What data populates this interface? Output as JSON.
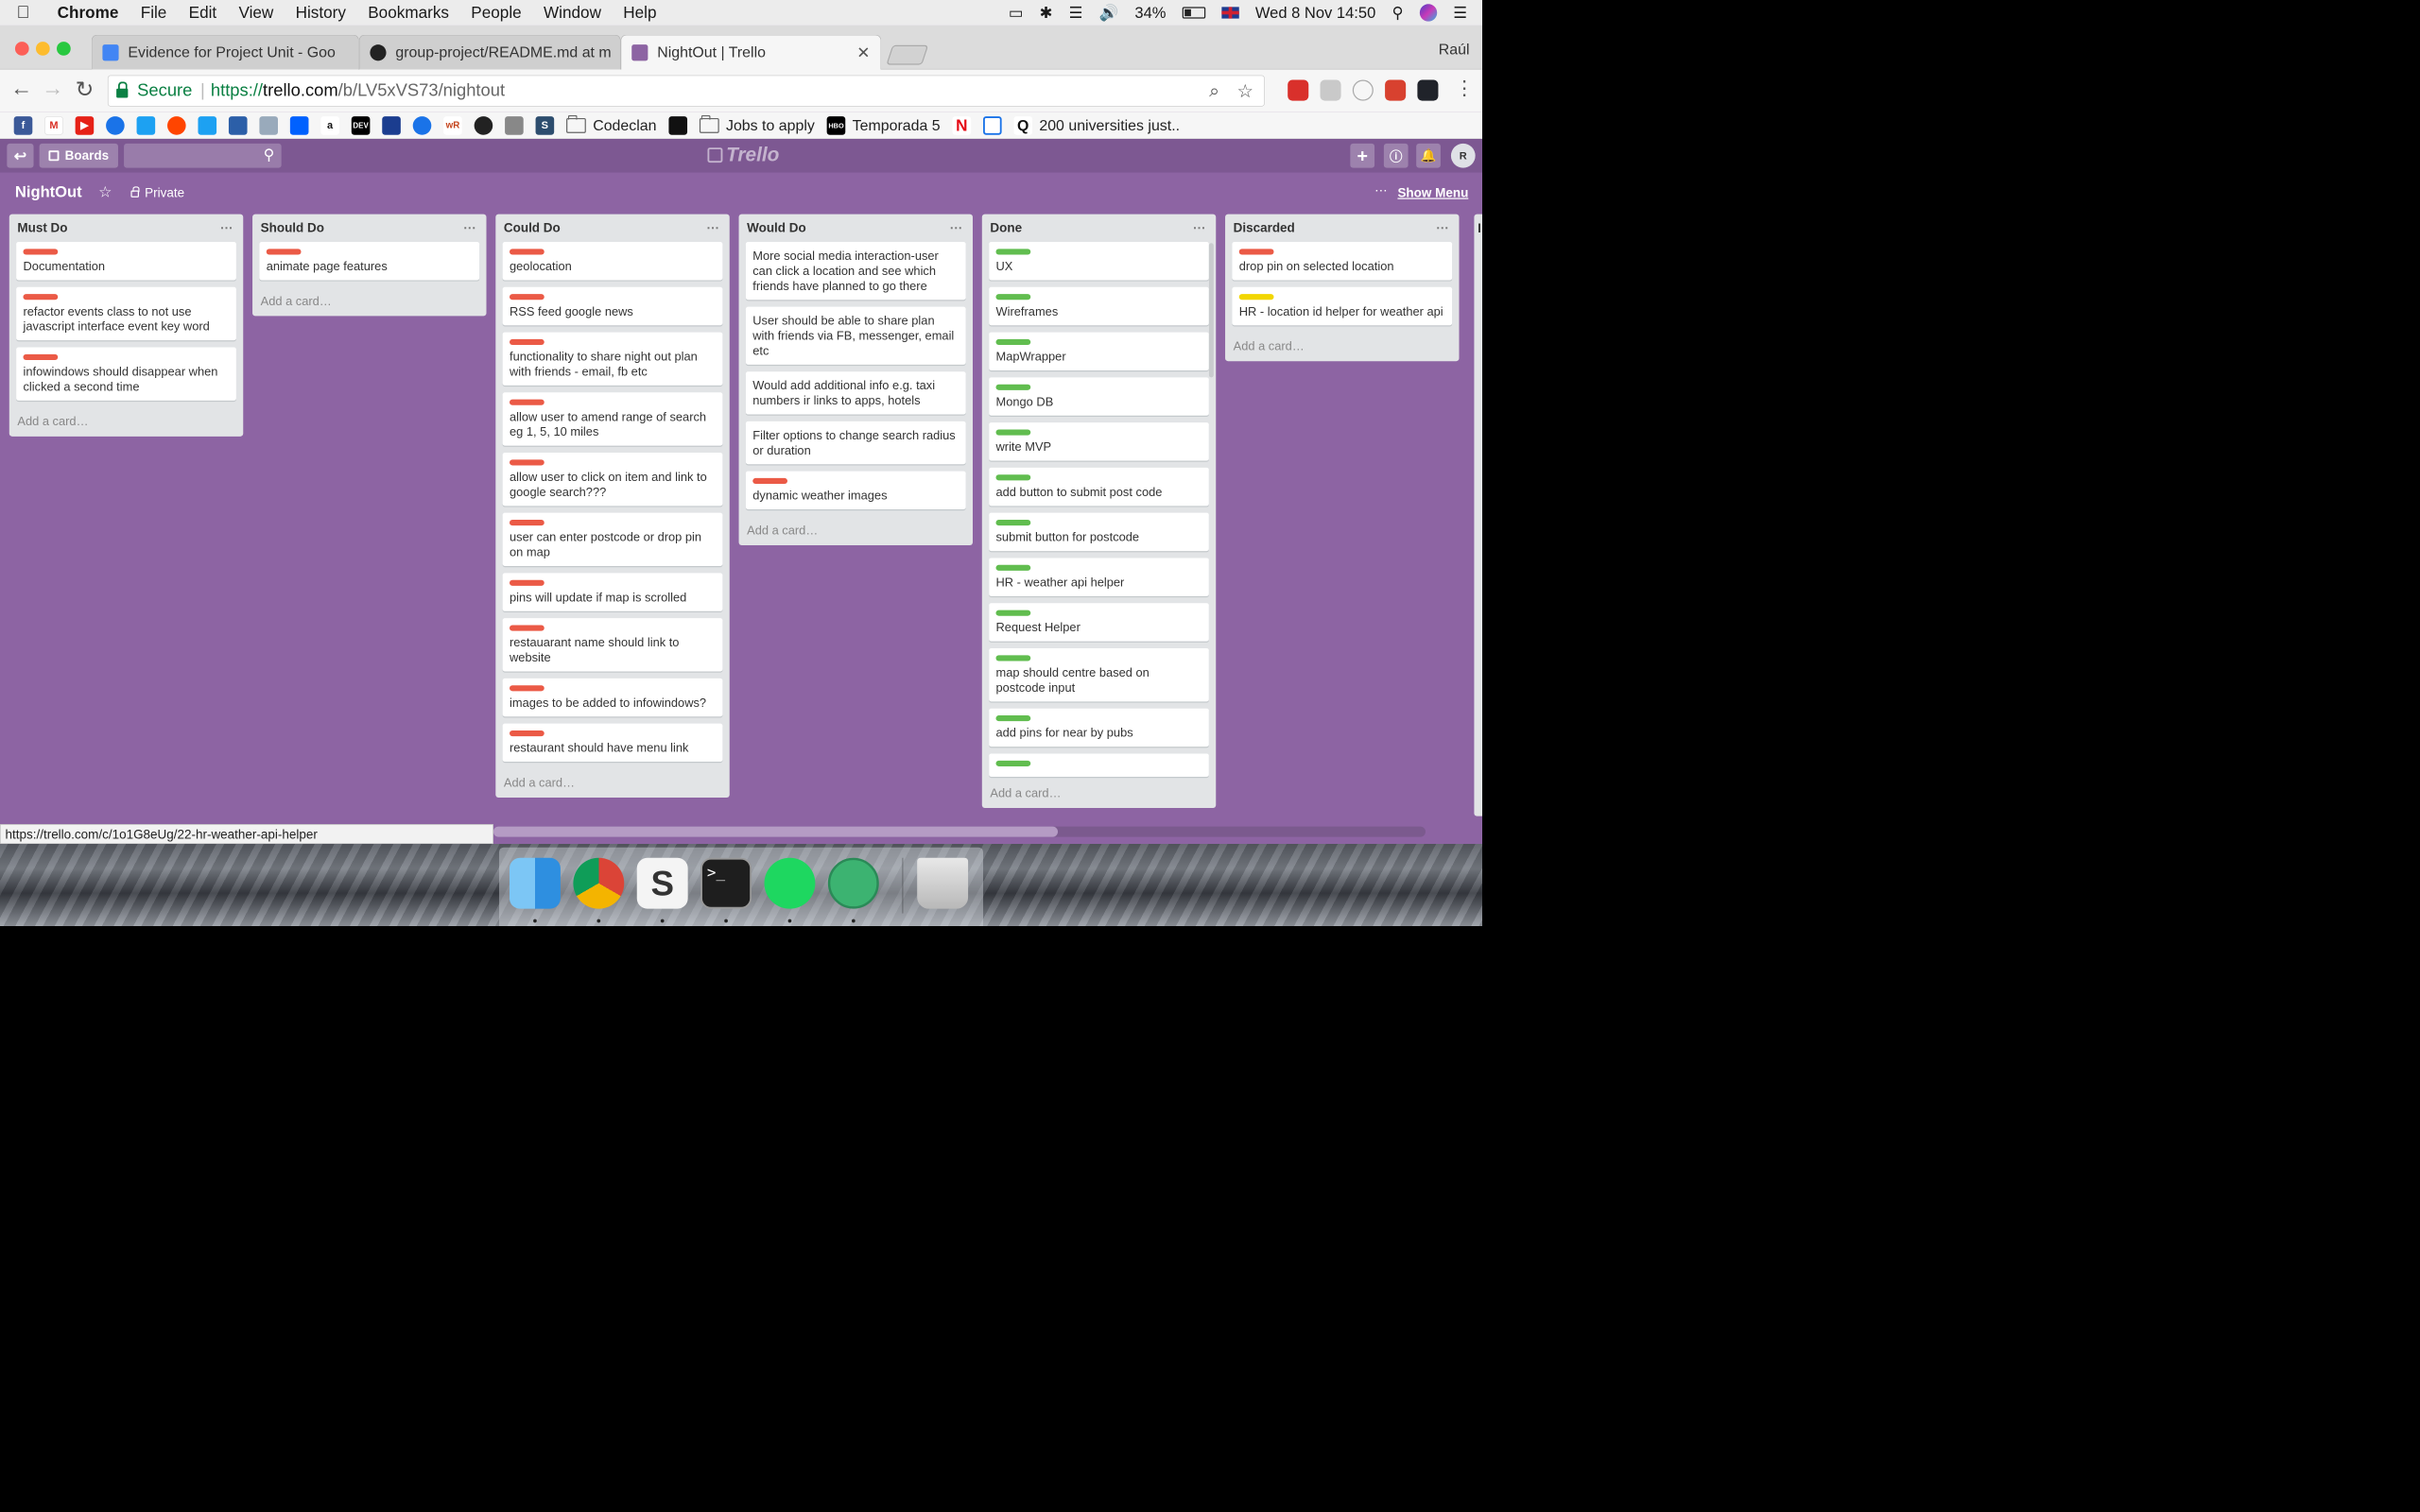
{
  "menubar": {
    "app": "Chrome",
    "items": [
      "File",
      "Edit",
      "View",
      "History",
      "Bookmarks",
      "People",
      "Window",
      "Help"
    ],
    "battery": "34%",
    "clock": "Wed 8 Nov  14:50"
  },
  "browser": {
    "tabs": [
      {
        "title": "Evidence for Project Unit - Goo",
        "favicon_color": "#4285f4",
        "active": false
      },
      {
        "title": "group-project/README.md at m",
        "favicon_color": "#222222",
        "active": false
      },
      {
        "title": "NightOut | Trello",
        "favicon_color": "#8d64a3",
        "active": true
      }
    ],
    "profile": "Raúl",
    "secure_label": "Secure",
    "url_proto": "https://",
    "url_host": "trello.com",
    "url_path": "/b/LV5xVS73/nightout",
    "status_url": "https://trello.com/c/1o1G8eUg/22-hr-weather-api-helper"
  },
  "bookmarks": {
    "folders": [
      "Codeclan",
      "Jobs to apply"
    ],
    "temporada": "Temporada 5",
    "universities": "200 universities just.."
  },
  "trello": {
    "boards_label": "Boards",
    "logo": "Trello",
    "avatar": "R",
    "board_title": "NightOut",
    "visibility": "Private",
    "show_menu": "Show Menu",
    "add_card": "Add a card…",
    "partial_list_initial": "I"
  },
  "colors": {
    "board_bg": "#8d64a3",
    "label_red": "#eb5a46",
    "label_green": "#61bd4f",
    "label_yellow": "#f2d600"
  },
  "lists": [
    {
      "name": "Must Do",
      "cards": [
        {
          "label": "red",
          "text": "Documentation"
        },
        {
          "label": "red",
          "text": "refactor events class to not use javascript interface event key word"
        },
        {
          "label": "red",
          "text": "infowindows should disappear when clicked a second time"
        }
      ]
    },
    {
      "name": "Should Do",
      "cards": [
        {
          "label": "red",
          "text": "animate page features"
        }
      ]
    },
    {
      "name": "Could Do",
      "cards": [
        {
          "label": "red",
          "text": "geolocation"
        },
        {
          "label": "red",
          "text": "RSS feed google news"
        },
        {
          "label": "red",
          "text": "functionality to share night out plan with friends - email, fb etc"
        },
        {
          "label": "red",
          "text": "allow user to amend range of search eg 1, 5, 10 miles"
        },
        {
          "label": "red",
          "text": "allow user to click on item and link to google search???"
        },
        {
          "label": "red",
          "text": "user can enter postcode or drop pin on map"
        },
        {
          "label": "red",
          "text": "pins will update if map is scrolled"
        },
        {
          "label": "red",
          "text": "restauarant name should link to website"
        },
        {
          "label": "red",
          "text": "images to be added to infowindows?"
        },
        {
          "label": "red",
          "text": "restaurant should have menu link"
        }
      ]
    },
    {
      "name": "Would Do",
      "cards": [
        {
          "label": null,
          "text": "More social media interaction-user can click a location and see which friends have planned to go there"
        },
        {
          "label": null,
          "text": "User should be able to share plan with friends via FB, messenger, email etc"
        },
        {
          "label": null,
          "text": "Would add additional info e.g. taxi numbers ir links to apps, hotels"
        },
        {
          "label": null,
          "text": "Filter options to change search radius or duration"
        },
        {
          "label": "red",
          "text": "dynamic weather images"
        }
      ]
    },
    {
      "name": "Done",
      "cards": [
        {
          "label": "green",
          "text": "UX"
        },
        {
          "label": "green",
          "text": "Wireframes"
        },
        {
          "label": "green",
          "text": "MapWrapper"
        },
        {
          "label": "green",
          "text": "Mongo DB"
        },
        {
          "label": "green",
          "text": "write MVP"
        },
        {
          "label": "green",
          "text": "add button to submit post code"
        },
        {
          "label": "green",
          "text": "submit button for postcode"
        },
        {
          "label": "green",
          "text": "HR - weather api helper"
        },
        {
          "label": "green",
          "text": "Request Helper"
        },
        {
          "label": "green",
          "text": "map should centre based on postcode input"
        },
        {
          "label": "green",
          "text": "add pins for near by pubs"
        },
        {
          "label": "green",
          "text": ""
        }
      ]
    },
    {
      "name": "Discarded",
      "cards": [
        {
          "label": "red",
          "text": "drop pin on selected location"
        },
        {
          "label": "yellow",
          "text": "HR - location id helper for weather api"
        }
      ]
    }
  ]
}
